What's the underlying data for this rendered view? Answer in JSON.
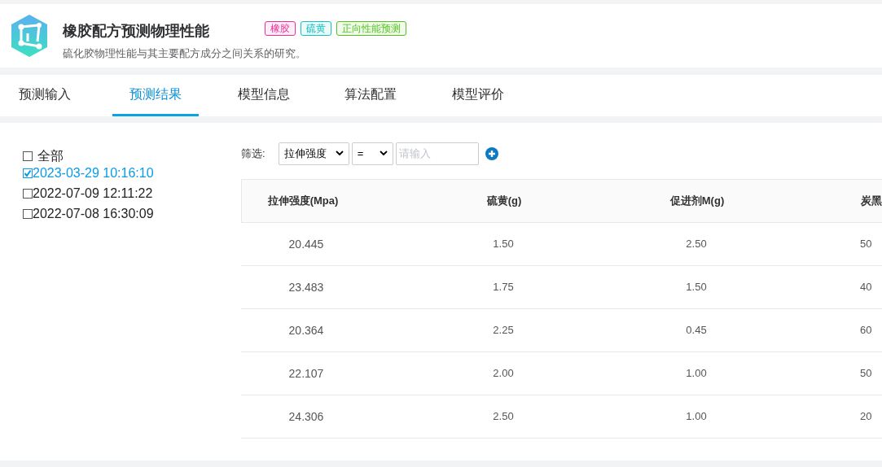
{
  "header": {
    "title": "橡胶配方预测物理性能",
    "description": "硫化胶物理性能与其主要配方成分之间关系的研究。",
    "tags": [
      {
        "label": "橡胶",
        "color": "#eb2f96"
      },
      {
        "label": "硫黄",
        "color": "#13c2c2"
      },
      {
        "label": "正向性能预测",
        "color": "#52c41a"
      }
    ]
  },
  "tabs": [
    {
      "label": "预测输入",
      "selected": false
    },
    {
      "label": "预测结果",
      "selected": true
    },
    {
      "label": "模型信息",
      "selected": false
    },
    {
      "label": "算法配置",
      "selected": false
    },
    {
      "label": "模型评价",
      "selected": false
    }
  ],
  "runs": [
    {
      "label": "全部",
      "checked": false
    },
    {
      "label": "2023-03-29 10:16:10",
      "checked": true
    },
    {
      "label": "2022-07-09 12:11:22",
      "checked": false
    },
    {
      "label": "2022-07-08 16:30:09",
      "checked": false
    }
  ],
  "filter": {
    "label": "筛选:",
    "field": "拉伸强度",
    "operator": "=",
    "placeholder": "请输入"
  },
  "table": {
    "columns": [
      "拉伸强度(Mpa)",
      "硫黄(g)",
      "促进剂M(g)",
      "炭黑"
    ],
    "rows": [
      [
        "20.445",
        "1.50",
        "2.50",
        "50"
      ],
      [
        "23.483",
        "1.75",
        "1.50",
        "40"
      ],
      [
        "20.364",
        "2.25",
        "0.45",
        "60"
      ],
      [
        "22.107",
        "2.00",
        "1.00",
        "50"
      ],
      [
        "24.306",
        "2.50",
        "1.00",
        "20"
      ]
    ]
  }
}
